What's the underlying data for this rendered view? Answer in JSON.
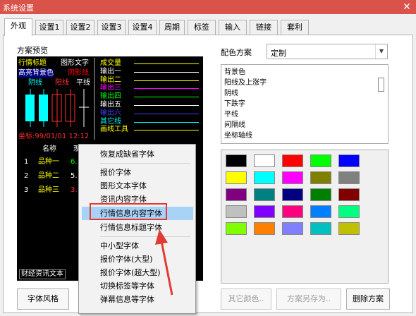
{
  "window": {
    "title": "系统设置",
    "close_icon": "close-icon"
  },
  "tabs": [
    "外观",
    "设置1",
    "设置2",
    "设置3",
    "设置4",
    "周期",
    "标签",
    "输入",
    "链接",
    "套利"
  ],
  "left": {
    "preview_label": "方案预览"
  },
  "preview": {
    "header1": "行情标题",
    "header2": "图形文字",
    "highlight_bg": "高亮背景色",
    "gray_label": "阴影线",
    "candles": {
      "down": "阴线",
      "up": "阳线",
      "flat": "平线"
    },
    "series_labels": [
      "成交量",
      "输出一",
      "输出二",
      "输出三",
      "输出四",
      "输出五",
      "输出六",
      "其它线",
      "画线工具"
    ],
    "series_colors": [
      "#ffff00",
      "#ffffff",
      "#ffff00",
      "#ff00ff",
      "#00ff00",
      "#ffffff",
      "#4040ff",
      "#00ffff",
      "#ffff00"
    ],
    "date_text": "坐标:99/01/01 12:12",
    "table_header": "名称",
    "table_header2": "现",
    "rows": [
      {
        "num": "1",
        "name": "品种一",
        "val": "6."
      },
      {
        "num": "2",
        "name": "品种二",
        "val": "5."
      },
      {
        "num": "3",
        "name": "品种三",
        "val": "3."
      }
    ],
    "bottom_tag": "财经资讯文本"
  },
  "right": {
    "scheme_label": "配色方案",
    "scheme_value": "定制",
    "dropdown_icon": "chevron-down-icon",
    "items": [
      "背景色",
      "阳线及上涨字",
      "阴线",
      "下跌字",
      "平线",
      "间隔线",
      "坐标轴线"
    ],
    "palette": [
      [
        "#000000",
        "#ffffff",
        "#ff0000",
        "#00ff00",
        "#0000ff"
      ],
      [
        "#ffff00",
        "#00ffff",
        "#ff00ff",
        "#808000",
        "#808080"
      ],
      [
        "#800080",
        "#008080",
        "#000080",
        "#008000",
        "#800000"
      ],
      [
        "#c0c0c0",
        "#8000ff",
        "#ff0080",
        "#0080ff",
        "#00ff80"
      ],
      [
        "#80ff00",
        "#ff8000",
        "#8080ff",
        "#00c0c0",
        "#c0c000"
      ]
    ]
  },
  "buttons": {
    "font_style": "字体风格",
    "other_color": "其它颜色..",
    "save_scheme": "方案另存为..",
    "delete_scheme": "删除方案"
  },
  "context_menu": {
    "items": [
      "恢复成缺省字体",
      "报价字体",
      "图形文本字体",
      "资讯内容字体",
      "行情信息内容字体",
      "行情信息标题字体",
      "中小型字体",
      "报价字体(大型)",
      "报价字体(超大型)",
      "切换标签等字体",
      "弹幕信息等字体"
    ],
    "highlighted_index": 4,
    "annotation_color": "#e23b36"
  }
}
